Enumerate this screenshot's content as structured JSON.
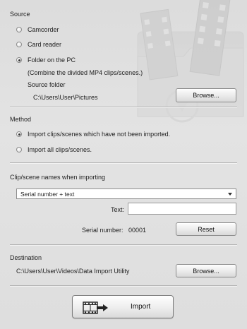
{
  "source": {
    "heading": "Source",
    "options": [
      {
        "label": "Camcorder",
        "selected": false
      },
      {
        "label": "Card reader",
        "selected": false
      },
      {
        "label": "Folder on the PC",
        "selected": true
      }
    ],
    "folder_note": "(Combine the divided MP4 clips/scenes.)",
    "source_folder_label": "Source folder",
    "source_folder_path": "C:\\Users\\User\\Pictures",
    "browse_label": "Browse..."
  },
  "method": {
    "heading": "Method",
    "options": [
      {
        "label": "Import clips/scenes which have not been imported.",
        "selected": true
      },
      {
        "label": "Import all clips/scenes.",
        "selected": false
      }
    ]
  },
  "naming": {
    "heading": "Clip/scene names when importing",
    "selected_option": "Serial number + text",
    "text_label": "Text:",
    "text_value": "",
    "serial_label": "Serial number:",
    "serial_value": "00001",
    "reset_label": "Reset"
  },
  "destination": {
    "heading": "Destination",
    "path": "C:\\Users\\User\\Videos\\Data Import Utility",
    "browse_label": "Browse..."
  },
  "import_button": {
    "label": "Import",
    "icon": "film-import-icon"
  }
}
